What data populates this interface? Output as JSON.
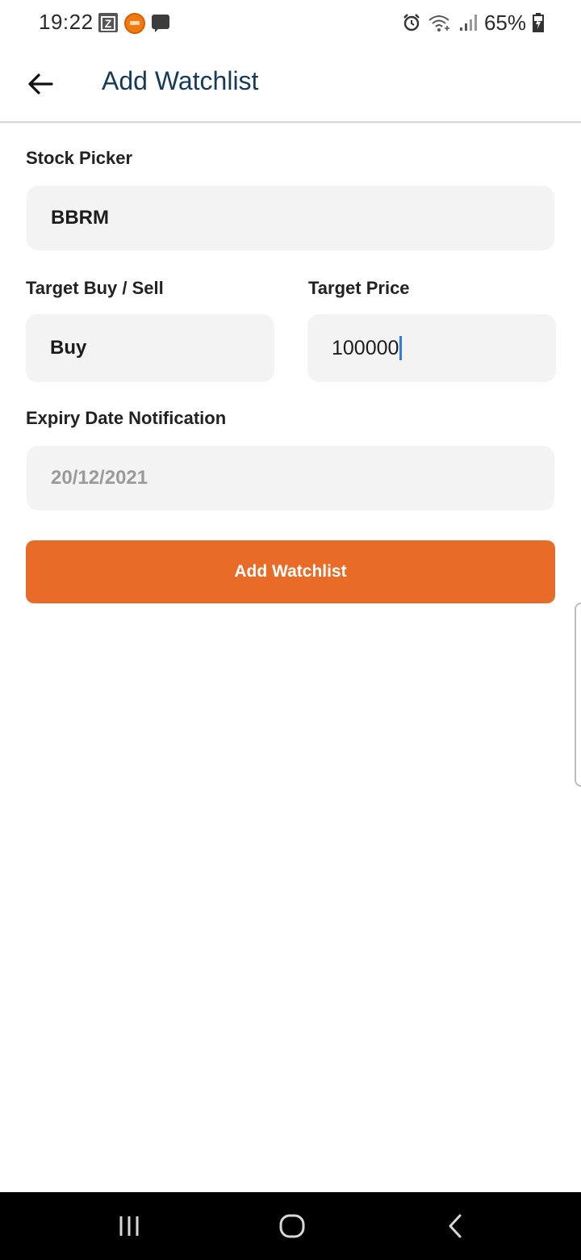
{
  "status_bar": {
    "time": "19:22",
    "battery_percent": "65%",
    "icons": [
      "z-app-icon",
      "game-app-icon",
      "message-icon",
      "alarm-icon",
      "wifi-icon",
      "signal-icon",
      "battery-icon"
    ]
  },
  "app_bar": {
    "title": "Add Watchlist",
    "back_icon": "arrow-left-icon"
  },
  "form": {
    "stock_picker": {
      "label": "Stock Picker",
      "value": "BBRM"
    },
    "target_buy_sell": {
      "label": "Target Buy / Sell",
      "value": "Buy"
    },
    "target_price": {
      "label": "Target Price",
      "value": "100000"
    },
    "expiry_date": {
      "label": "Expiry Date Notification",
      "placeholder": "20/12/2021"
    },
    "submit_label": "Add Watchlist"
  },
  "colors": {
    "title": "#143c5a",
    "button": "#e86c27",
    "field_bg": "#f3f3f3",
    "caret": "#2f7de1"
  },
  "nav_bar": {
    "buttons": [
      "recent-apps-icon",
      "home-icon",
      "back-icon"
    ]
  }
}
